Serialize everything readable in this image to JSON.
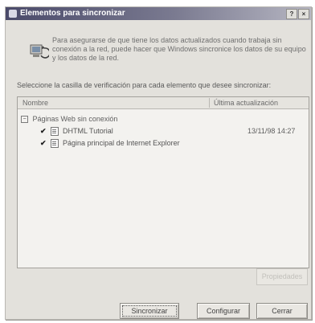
{
  "window": {
    "title": "Elementos para sincronizar",
    "help_button": "?",
    "close_button": "×"
  },
  "intro": {
    "text": "Para asegurarse de que tiene los datos actualizados cuando trabaja sin conexión a la red, puede hacer que Windows sincronice los datos de su equipo y los datos de la red."
  },
  "instruction": "Seleccione la casilla de verificación para cada elemento que desee sincronizar:",
  "list": {
    "columns": {
      "name": "Nombre",
      "last_update": "Última actualización"
    },
    "group": {
      "expander": "−",
      "label": "Páginas Web sin conexión"
    },
    "items": [
      {
        "checked": true,
        "check_glyph": "✔",
        "name": "DHTML Tutorial",
        "last_update": "13/11/98 14:27"
      },
      {
        "checked": true,
        "check_glyph": "✔",
        "name": "Página principal de Internet Explorer",
        "last_update": ""
      }
    ]
  },
  "buttons": {
    "properties": "Propiedades",
    "sync": "Sincronizar",
    "configure": "Configurar",
    "close": "Cerrar"
  },
  "icons": {
    "app": "sync-icon",
    "intro": "computer-sync-icon",
    "page": "web-page-icon"
  },
  "colors": {
    "title_bar_start": "#4a4a6a",
    "title_bar_end": "#b6b6c2",
    "dialog_bg": "#e3e1dc"
  }
}
